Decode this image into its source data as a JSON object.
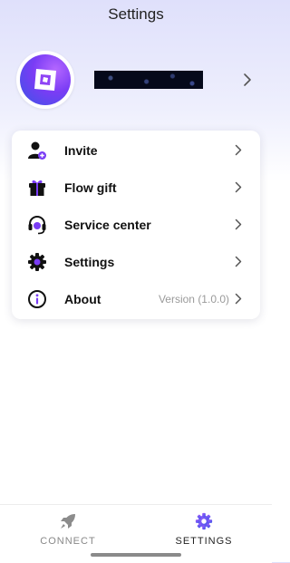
{
  "header": {
    "title": "Settings"
  },
  "profile": {
    "avatar_icon": "logo-icon",
    "chevron_icon": "chevron-right-icon"
  },
  "menu": {
    "items": [
      {
        "label": "Invite",
        "icon": "user-plus-icon"
      },
      {
        "label": "Flow gift",
        "icon": "gift-icon"
      },
      {
        "label": "Service center",
        "icon": "headset-icon"
      },
      {
        "label": "Settings",
        "icon": "gear-icon"
      },
      {
        "label": "About",
        "icon": "info-icon",
        "version": "Version (1.0.0)"
      }
    ]
  },
  "bottom_nav": {
    "items": [
      {
        "label": "CONNECT",
        "icon": "rocket-icon",
        "active": false
      },
      {
        "label": "SETTINGS",
        "icon": "gear-icon",
        "active": true
      }
    ]
  },
  "colors": {
    "accent": "#7a3cf5",
    "accent_secondary": "#3a56e6",
    "text_primary": "#111111",
    "text_muted": "#9a9a9a"
  }
}
